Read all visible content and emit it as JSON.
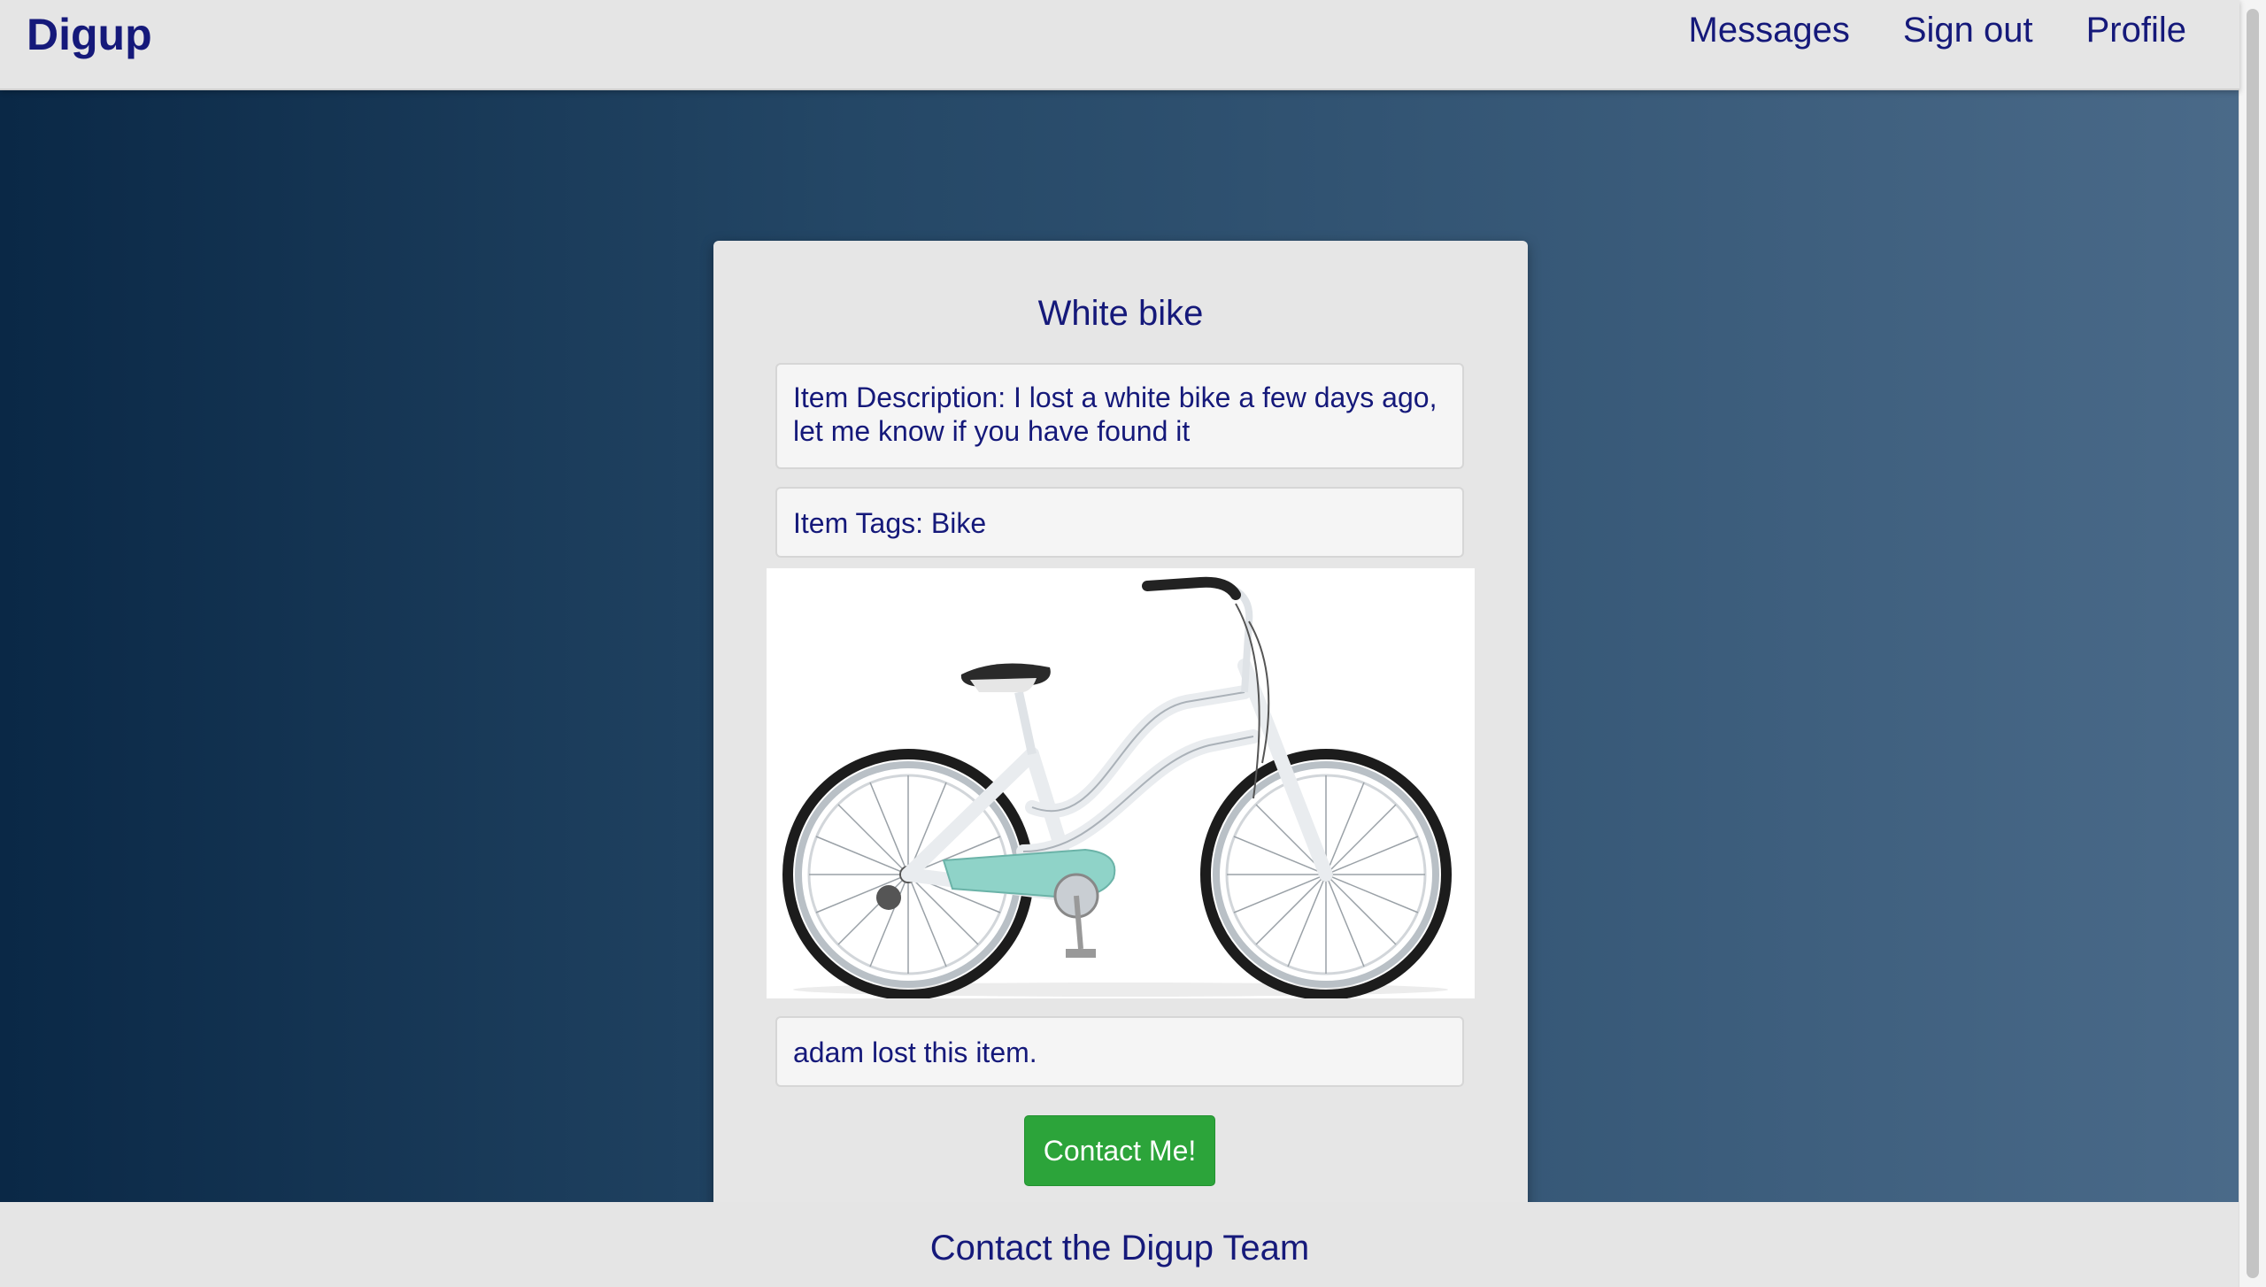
{
  "navbar": {
    "brand": "Digup",
    "links": [
      "Messages",
      "Sign out",
      "Profile"
    ]
  },
  "item": {
    "title": "White bike",
    "description": "Item Description: I lost a white bike a few days ago, let me know if you have found it",
    "tags": "Item Tags: Bike",
    "owner_note": "adam lost this item.",
    "image_icon": "bicycle-photo",
    "contact_label": "Contact Me!"
  },
  "footer": {
    "contact_label": "Contact the Digup Team"
  },
  "colors": {
    "nav_bg": "#e5e5e5",
    "text": "#15197a",
    "hero_left": "#0a2846",
    "hero_right": "#4a6a89",
    "card_bg": "#e6e6e6",
    "button": "#2ca43a"
  }
}
